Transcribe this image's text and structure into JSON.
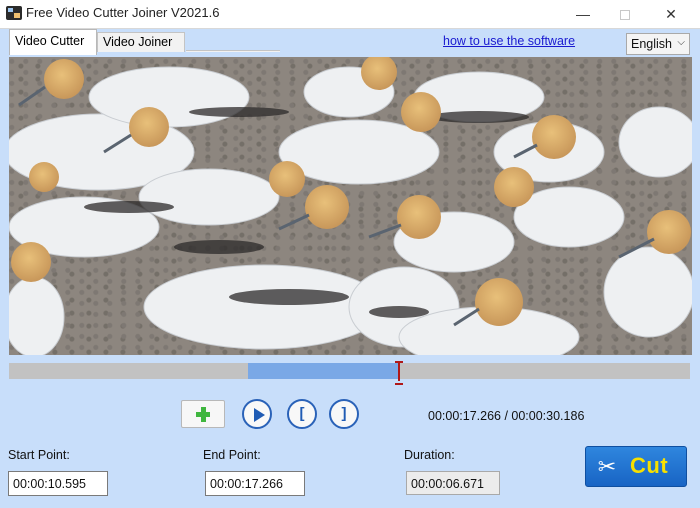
{
  "window": {
    "title": "Free Video Cutter Joiner V2021.6",
    "minimize_glyph": "—",
    "close_glyph": "✕"
  },
  "tabs": [
    {
      "label": "Video Cutter",
      "active": true
    },
    {
      "label": "Video Joiner",
      "active": false
    }
  ],
  "help_link": "how to use the software",
  "language": {
    "selected": "English",
    "arrow": "⌵"
  },
  "timeline": {
    "selection_start_seconds": 10.595,
    "selection_end_seconds": 17.266,
    "total_seconds": 30.186
  },
  "controls": {
    "start_mark": "[",
    "end_mark": "]",
    "time_readout": "00:00:17.266 / 00:00:30.186"
  },
  "fields": {
    "start_label": "Start Point:",
    "start_value": "00:00:10.595",
    "end_label": "End Point:",
    "end_value": "00:00:17.266",
    "duration_label": "Duration:",
    "duration_value": "00:00:06.671"
  },
  "cut_button": {
    "label": "Cut",
    "icon": "✂"
  },
  "colors": {
    "accent": "#1864c4",
    "cut_text": "#f7e000",
    "background": "#c8defa"
  }
}
